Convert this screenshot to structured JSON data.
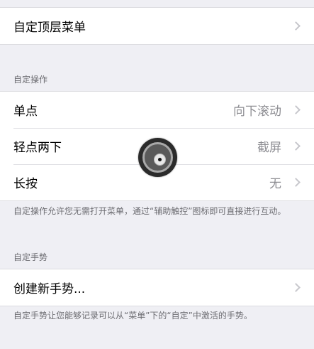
{
  "top_group": {
    "items": [
      {
        "label": "自定顶层菜单",
        "value": ""
      }
    ]
  },
  "custom_actions": {
    "header": "自定操作",
    "items": [
      {
        "label": "单点",
        "value": "向下滚动"
      },
      {
        "label": "轻点两下",
        "value": "截屏"
      },
      {
        "label": "长按",
        "value": "无"
      }
    ],
    "footer": "自定操作允许您无需打开菜单，通过“辅助触控”图标即可直接进行互动。"
  },
  "custom_gestures": {
    "header": "自定手势",
    "items": [
      {
        "label": "创建新手势...",
        "value": ""
      }
    ],
    "footer": "自定手势让您能够记录可以从“菜单”下的“自定”中激活的手势。"
  },
  "icons": {
    "chevron": "chevron-right-icon",
    "assistive_touch": "assistive-touch-icon"
  },
  "colors": {
    "background": "#efeff4",
    "cell_background": "#ffffff",
    "secondary_text": "#8e8e93",
    "header_text": "#6d6d72",
    "chevron": "#c7c7cc"
  }
}
